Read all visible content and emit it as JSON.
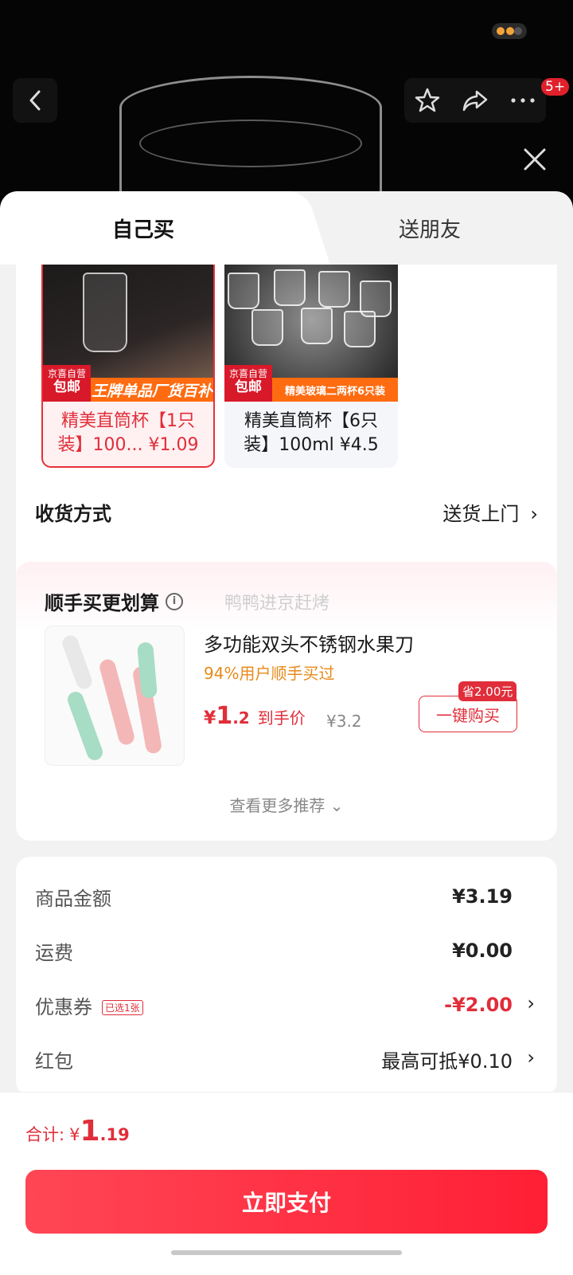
{
  "header": {
    "badge": "5+"
  },
  "tabs": {
    "self_buy": "自己买",
    "gift_friend": "送朋友"
  },
  "products": [
    {
      "tag_top": "京喜自营",
      "tag_bottom": "包邮",
      "promo": "王牌单品厂货百补",
      "title": "精美直筒杯【1只装】100... ¥1.09",
      "selected": true
    },
    {
      "tag_top": "京喜自营",
      "tag_bottom": "包邮",
      "promo": "精美玻璃二两杯6只装",
      "title": "精美直筒杯【6只装】100ml ¥4.5",
      "selected": false
    }
  ],
  "delivery": {
    "label": "收货方式",
    "value": "送货上门"
  },
  "addon": {
    "title": "顺手买更划算",
    "watermark": "鸭鸭进京赶烤",
    "item_name": "多功能双头不锈钢水果刀",
    "social_proof": "94%用户顺手买过",
    "price_symbol": "¥",
    "price_int": "1",
    "price_dec": ".2",
    "price_label": "到手价",
    "old_price": "¥3.2",
    "save_tag": "省2.00元",
    "buy_label": "一键购买",
    "see_more": "查看更多推荐"
  },
  "summary": {
    "goods_label": "商品金额",
    "goods_value": "¥3.19",
    "shipping_label": "运费",
    "shipping_value": "¥0.00",
    "coupon_label": "优惠券",
    "coupon_tag": "已选1张",
    "coupon_value": "-¥2.00",
    "redpacket_label": "红包",
    "redpacket_value": "最高可抵¥0.10"
  },
  "footer": {
    "total_label": "合计:",
    "total_symbol": "¥",
    "total_int": "1",
    "total_dec": ".19",
    "pay_label": "立即支付"
  },
  "colors": {
    "accent": "#e02e3a",
    "pay_button": "#ff2b3e",
    "social_proof": "#e88a1a"
  },
  "icons": [
    "back-icon",
    "star-icon",
    "share-icon",
    "more-icon",
    "close-icon",
    "info-icon",
    "chevron-right-icon",
    "chevron-down-icon"
  ]
}
